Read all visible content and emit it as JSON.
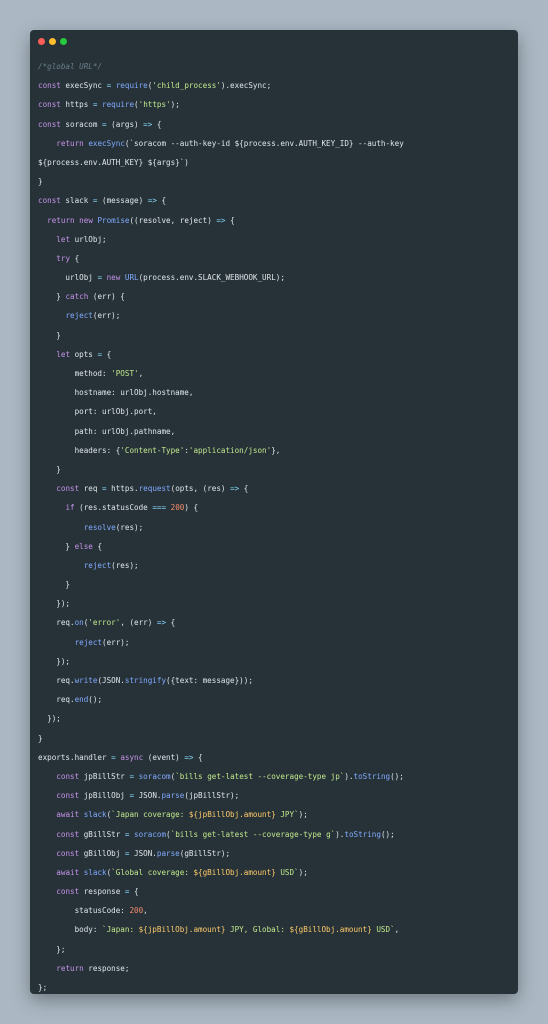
{
  "window": {
    "controls": [
      {
        "name": "close",
        "color": "#ff5f56"
      },
      {
        "name": "minimize",
        "color": "#ffbd2e"
      },
      {
        "name": "maximize",
        "color": "#27c93f"
      }
    ]
  },
  "code_lines": [
    "/*global URL*/",
    "const execSync = require('child_process').execSync;",
    "const https = require('https');",
    "const soracom = (args) => {",
    "    return execSync(`soracom --auth-key-id ${process.env.AUTH_KEY_ID} --auth-key\n${process.env.AUTH_KEY} ${args}`)",
    "}",
    "const slack = (message) => {",
    "  return new Promise((resolve, reject) => {",
    "    let urlObj;",
    "    try {",
    "      urlObj = new URL(process.env.SLACK_WEBHOOK_URL);",
    "    } catch (err) {",
    "      reject(err);",
    "    }",
    "    let opts = {",
    "        method: 'POST',",
    "        hostname: urlObj.hostname,",
    "        port: urlObj.port,",
    "        path: urlObj.pathname,",
    "        headers: {'Content-Type':'application/json'},",
    "    }",
    "    const req = https.request(opts, (res) => {",
    "      if (res.statusCode === 200) {",
    "          resolve(res);",
    "      } else {",
    "          reject(res);",
    "      }",
    "    });",
    "    req.on('error', (err) => {",
    "        reject(err);",
    "    });",
    "    req.write(JSON.stringify({text: message}));",
    "    req.end();",
    "  });",
    "}",
    "exports.handler = async (event) => {",
    "    const jpBillStr = soracom(`bills get-latest --coverage-type jp`).toString();",
    "    const jpBillObj = JSON.parse(jpBillStr);",
    "    await slack(`Japan coverage: ${jpBillObj.amount} JPY`);",
    "    const gBillStr = soracom(`bills get-latest --coverage-type g`).toString();",
    "    const gBillObj = JSON.parse(gBillStr);",
    "    await slack(`Global coverage: ${gBillObj.amount} USD`);",
    "    const response = {",
    "        statusCode: 200,",
    "        body: `Japan: ${jpBillObj.amount} JPY, Global: ${gBillObj.amount} USD`,",
    "    };",
    "    return response;",
    "};"
  ]
}
